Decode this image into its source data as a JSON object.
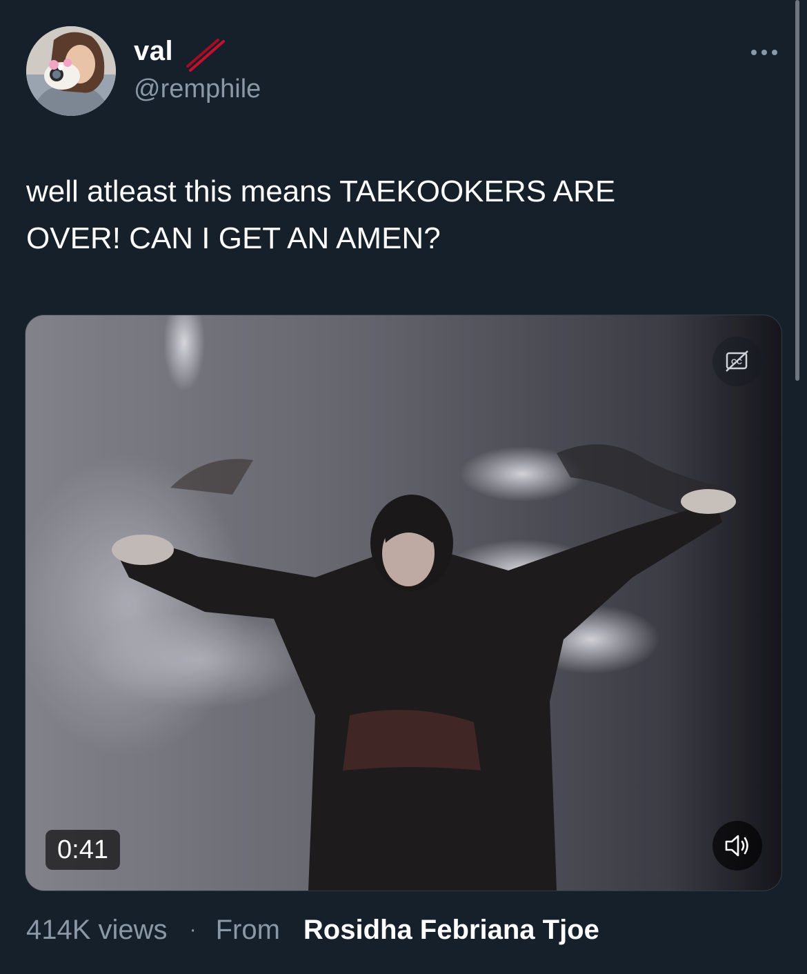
{
  "author": {
    "display_name": "val",
    "handle": "@remphile",
    "name_emoji": "chopsticks-icon"
  },
  "tweet": {
    "text": "well atleast this means TAEKOOKERS ARE\nOVER! CAN I GET AN AMEN?"
  },
  "video": {
    "duration": "0:41",
    "views": "414K views",
    "separator": "·",
    "from_label": "From",
    "source": "Rosidha Febriana Tjoe",
    "controls": [
      "closed-captions-off-icon",
      "volume-icon",
      "more-icon"
    ]
  },
  "colors": {
    "background": "#15202b",
    "primary_text": "#ffffff",
    "secondary_text": "#8b98a5",
    "emoji_red": "#c8102e"
  }
}
